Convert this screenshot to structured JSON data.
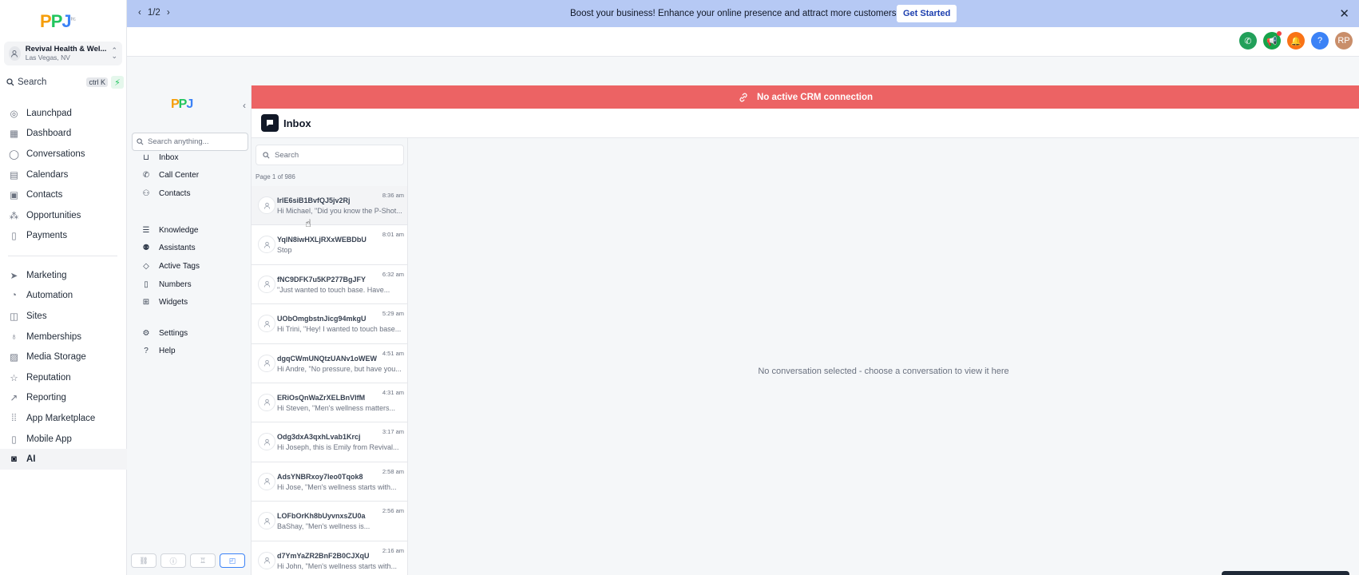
{
  "brand": {
    "logo_text_p1": "P",
    "logo_text_p2": "P",
    "logo_text_j": "J",
    "logo_tm": "Inc."
  },
  "location": {
    "name": "Revival Health & Wel...",
    "city": "Las Vegas, NV"
  },
  "search": {
    "label": "Search",
    "shortcut": "ctrl K"
  },
  "nav": {
    "group1": [
      "Launchpad",
      "Dashboard",
      "Conversations",
      "Calendars",
      "Contacts",
      "Opportunities",
      "Payments"
    ],
    "group2": [
      "Marketing",
      "Automation",
      "Sites",
      "Memberships",
      "Media Storage",
      "Reputation",
      "Reporting",
      "App Marketplace",
      "Mobile App",
      "AI"
    ],
    "active": "AI"
  },
  "promo": {
    "pager": "1/2",
    "message": "Boost your business! Enhance your online presence and attract more customers with ease.",
    "button": "Get Started"
  },
  "header": {
    "avatar_initials": "RP"
  },
  "inner_sidebar": {
    "search_placeholder": "Search anything...",
    "items1": [
      "Inbox",
      "Call Center",
      "Contacts"
    ],
    "items2": [
      "Knowledge",
      "Assistants",
      "Active Tags",
      "Numbers",
      "Widgets"
    ],
    "items3": [
      "Settings",
      "Help"
    ]
  },
  "crm_banner": "No active CRM connection",
  "inbox": {
    "title": "Inbox",
    "search_placeholder": "Search",
    "page_info": "Page 1 of 986",
    "empty_state": "No conversation selected - choose a conversation to view it here",
    "conversations": [
      {
        "name": "IrlE6siB1BvfQJ5jv2Rj",
        "preview": "Hi Michael, \"Did you know the P-Shot...",
        "time": "8:36 am"
      },
      {
        "name": "YqlN8iwHXLjRXxWEBDbU",
        "preview": "Stop",
        "time": "8:01 am"
      },
      {
        "name": "fNC9DFK7u5KP277BgJFY",
        "preview": "\"Just wanted to touch base. Have...",
        "time": "6:32 am"
      },
      {
        "name": "UObOmgbstnJicg94mkgU",
        "preview": "Hi Trini, \"Hey! I wanted to touch base...",
        "time": "5:29 am"
      },
      {
        "name": "dgqCWmUNQtzUANv1oWEW",
        "preview": "Hi Andre, \"No pressure, but have you...",
        "time": "4:51 am"
      },
      {
        "name": "ERiOsQnWaZrXELBnVIfM",
        "preview": "Hi Steven, \"Men's wellness matters...",
        "time": "4:31 am"
      },
      {
        "name": "Odg3dxA3qxhLvab1Krcj",
        "preview": "Hi Joseph, this is Emily from Revival...",
        "time": "3:17 am"
      },
      {
        "name": "AdsYNBRxoy7leo0Tqok8",
        "preview": "Hi Jose, \"Men's wellness starts with...",
        "time": "2:58 am"
      },
      {
        "name": "LOFbOrKh8bUyvnxsZU0a",
        "preview": "BaShay, \"Men's wellness is...",
        "time": "2:56 am"
      },
      {
        "name": "d7YmYaZR2BnF2B0CJXqU",
        "preview": "Hi John, \"Men's wellness starts with...",
        "time": "2:16 am"
      }
    ]
  },
  "colors": {
    "promo": "#b6c9f4",
    "crm_banner": "#ec6364",
    "accent": "#3b82f6"
  }
}
